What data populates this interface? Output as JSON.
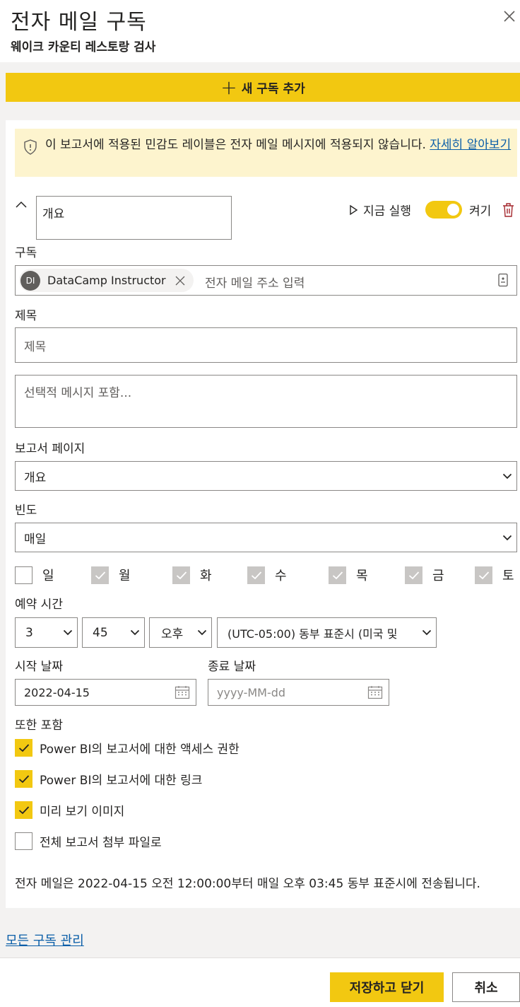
{
  "header": {
    "title": "전자 메일 구독",
    "subtitle": "웨이크 카운티 레스토랑 검사"
  },
  "add_button": {
    "plus": "+",
    "label": "새 구독 추가"
  },
  "banner": {
    "text": "이 보고서에 적용된 민감도 레이블은 전자 메일 메시지에 적용되지 않습니다. ",
    "link": "자세히 알아보기"
  },
  "subscription": {
    "name": "개요",
    "run_now": "지금 실행",
    "toggle_label": "켜기",
    "toggle_on": true
  },
  "recipients": {
    "label": "구독",
    "chip_initials": "DI",
    "chip_name": "DataCamp Instructor",
    "placeholder": "전자 메일 주소 입력"
  },
  "subject": {
    "label": "제목",
    "placeholder": "제목"
  },
  "message": {
    "placeholder": "선택적 메시지 포함..."
  },
  "report_page": {
    "label": "보고서 페이지",
    "value": "개요"
  },
  "frequency": {
    "label": "빈도",
    "value": "매일"
  },
  "days": [
    {
      "label": "일",
      "state": "unchecked"
    },
    {
      "label": "월",
      "state": "checked-disabled"
    },
    {
      "label": "화",
      "state": "checked-disabled"
    },
    {
      "label": "수",
      "state": "checked-disabled"
    },
    {
      "label": "목",
      "state": "checked-disabled"
    },
    {
      "label": "금",
      "state": "checked-disabled"
    },
    {
      "label": "토",
      "state": "checked-disabled"
    }
  ],
  "schedule": {
    "label": "예약 시간",
    "hour": "3",
    "minute": "45",
    "ampm": "오후",
    "timezone": "(UTC-05:00) 동부 표준시 (미국 및"
  },
  "dates": {
    "start_label": "시작 날짜",
    "start_value": "2022-04-15",
    "end_label": "종료 날짜",
    "end_placeholder": "yyyy-MM-dd"
  },
  "include": {
    "label": "또한 포함",
    "options": [
      {
        "label": "Power BI의 보고서에 대한 액세스 권한",
        "checked": true
      },
      {
        "label": "Power BI의 보고서에 대한 링크",
        "checked": true
      },
      {
        "label": "미리 보기 이미지",
        "checked": true
      },
      {
        "label": "전체 보고서 첨부 파일로",
        "checked": false
      }
    ]
  },
  "summary": "전자 메일은 2022-04-15 오전 12:00:00부터 매일 오후 03:45 동부 표준시에 전송됩니다.",
  "manage_link": "모든 구독 관리",
  "footer": {
    "save": "저장하고 닫기",
    "cancel": "취소"
  },
  "colors": {
    "accent": "#f2c811",
    "link": "#0a5ea8",
    "banner_bg": "#fdf4ce",
    "body_gray": "#f3f2f1"
  }
}
